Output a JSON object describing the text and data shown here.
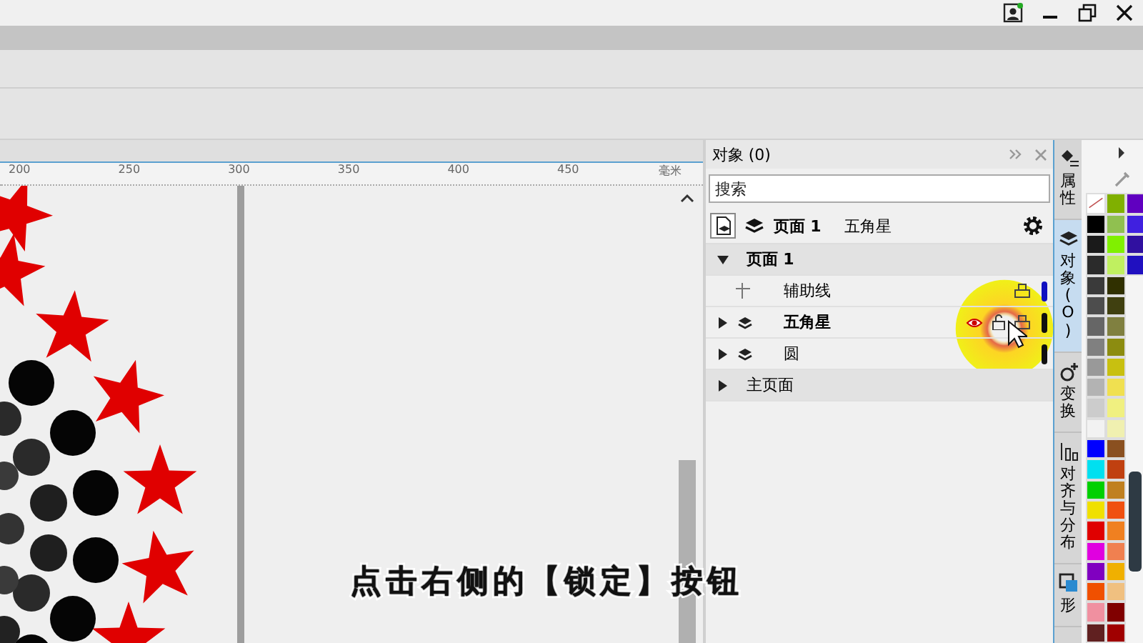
{
  "ruler": {
    "ticks": [
      "200",
      "250",
      "300",
      "350",
      "400",
      "450"
    ],
    "unit": "毫米"
  },
  "docker": {
    "title": "对象 (0)",
    "search": {
      "placeholder": "搜索"
    },
    "breadcrumb": {
      "page": "页面 1",
      "layer": "五角星"
    },
    "tree": [
      {
        "label": "页面 1",
        "kind": "page",
        "expanded": true,
        "children": [
          {
            "label": "辅助线",
            "kind": "guides",
            "color": "#1010c0",
            "active": false
          },
          {
            "label": "五角星",
            "kind": "layer",
            "expanded": false,
            "color": "#101010",
            "active": true
          },
          {
            "label": "圆",
            "kind": "layer",
            "expanded": false,
            "color": "#101010",
            "active": false
          }
        ]
      },
      {
        "label": "主页面",
        "kind": "page",
        "expanded": false
      }
    ]
  },
  "side_tabs": [
    {
      "label": "属性",
      "selected": false
    },
    {
      "label": "对象 (O)",
      "selected": true
    },
    {
      "label": "变换",
      "selected": false
    },
    {
      "label": "对齐与分布",
      "selected": false
    },
    {
      "label": "形",
      "selected": false
    }
  ],
  "subtitle": "点击右侧的【锁定】按钮",
  "palette": {
    "swatches": [
      {
        "kind": "none"
      },
      {
        "kind": "color",
        "color": "#000000"
      },
      {
        "kind": "color",
        "color": "#1a1a1a"
      },
      {
        "kind": "color",
        "color": "#2b2b2b"
      },
      {
        "kind": "color",
        "color": "#3a3a3a"
      },
      {
        "kind": "color",
        "color": "#4d4d4d"
      },
      {
        "kind": "color",
        "color": "#666666"
      },
      {
        "kind": "color",
        "color": "#808080"
      },
      {
        "kind": "color",
        "color": "#999999"
      },
      {
        "kind": "color",
        "color": "#b3b3b3"
      },
      {
        "kind": "color",
        "color": "#cccccc"
      },
      {
        "kind": "color",
        "color": "#f2f2f2"
      },
      {
        "kind": "color",
        "color": "#0000ff"
      },
      {
        "kind": "color",
        "color": "#00e0f0"
      },
      {
        "kind": "color",
        "color": "#00d000"
      },
      {
        "kind": "color",
        "color": "#f0e000"
      },
      {
        "kind": "color",
        "color": "#e00000"
      },
      {
        "kind": "color",
        "color": "#e000e0"
      },
      {
        "kind": "color",
        "color": "#8000c0"
      },
      {
        "kind": "color",
        "color": "#f05000"
      },
      {
        "kind": "color",
        "color": "#f090a0"
      },
      {
        "kind": "color",
        "color": "#602020"
      },
      {
        "kind": "color",
        "color": "#80b000"
      },
      {
        "kind": "color",
        "color": "#90c050"
      },
      {
        "kind": "color",
        "color": "#80f000"
      },
      {
        "kind": "color",
        "color": "#c0f060"
      },
      {
        "kind": "color",
        "color": "#303000"
      },
      {
        "kind": "color",
        "color": "#404010"
      },
      {
        "kind": "color",
        "color": "#808040"
      },
      {
        "kind": "color",
        "color": "#8c8c10"
      },
      {
        "kind": "color",
        "color": "#c8c010"
      },
      {
        "kind": "color",
        "color": "#f0e050"
      },
      {
        "kind": "color",
        "color": "#f0f080"
      },
      {
        "kind": "color",
        "color": "#f0f0b0"
      },
      {
        "kind": "color",
        "color": "#8a5020"
      },
      {
        "kind": "color",
        "color": "#c04010"
      },
      {
        "kind": "color",
        "color": "#c08020"
      },
      {
        "kind": "color",
        "color": "#f05010"
      },
      {
        "kind": "color",
        "color": "#f08020"
      },
      {
        "kind": "color",
        "color": "#f08050"
      },
      {
        "kind": "color",
        "color": "#f0b000"
      },
      {
        "kind": "color",
        "color": "#f0c080"
      },
      {
        "kind": "color",
        "color": "#800000"
      },
      {
        "kind": "color",
        "color": "#a00000"
      },
      {
        "kind": "color",
        "color": "#6000c0"
      },
      {
        "kind": "color",
        "color": "#4020e0"
      },
      {
        "kind": "color",
        "color": "#3010a0"
      },
      {
        "kind": "color",
        "color": "#2010c0"
      }
    ]
  }
}
